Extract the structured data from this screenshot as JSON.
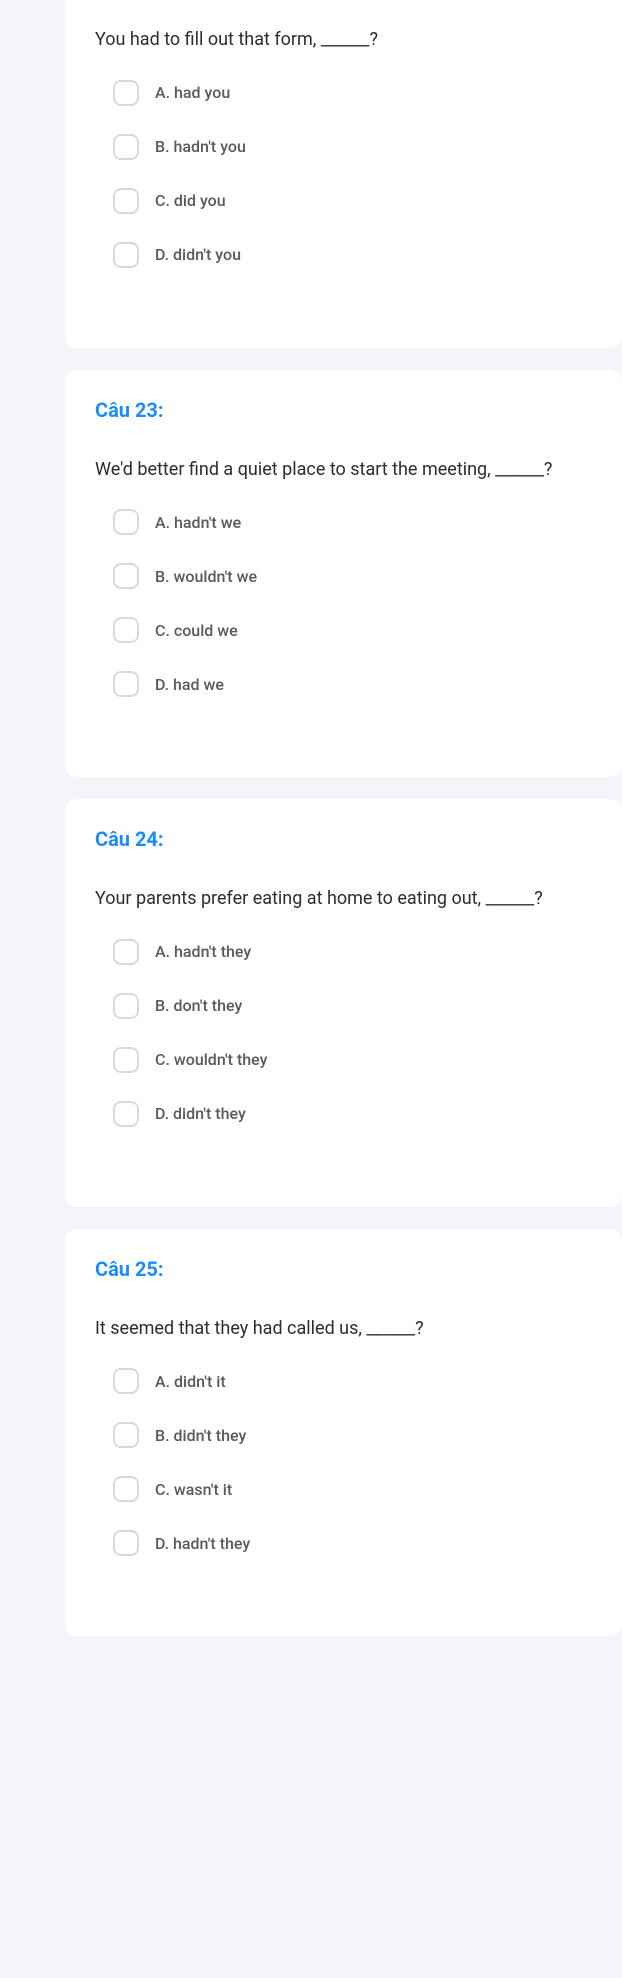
{
  "questions": [
    {
      "number": "",
      "text": "You had to fill out that form, ______?",
      "options": [
        "A. had you",
        "B. hadn't you",
        "C. did you",
        "D. didn't you"
      ]
    },
    {
      "number": "Câu 23:",
      "text": "We'd better find a quiet place to start the meeting, ______?",
      "options": [
        "A. hadn't we",
        "B. wouldn't we",
        "C. could we",
        "D. had we"
      ]
    },
    {
      "number": "Câu 24:",
      "text": "Your parents prefer eating at home to eating out, ______?",
      "options": [
        "A. hadn't they",
        "B. don't they",
        "C. wouldn't they",
        "D. didn't they"
      ]
    },
    {
      "number": "Câu 25:",
      "text": "It seemed that they had called us, ______?",
      "options": [
        "A. didn't it",
        "B. didn't they",
        "C. wasn't it",
        "D. hadn't they"
      ]
    }
  ]
}
